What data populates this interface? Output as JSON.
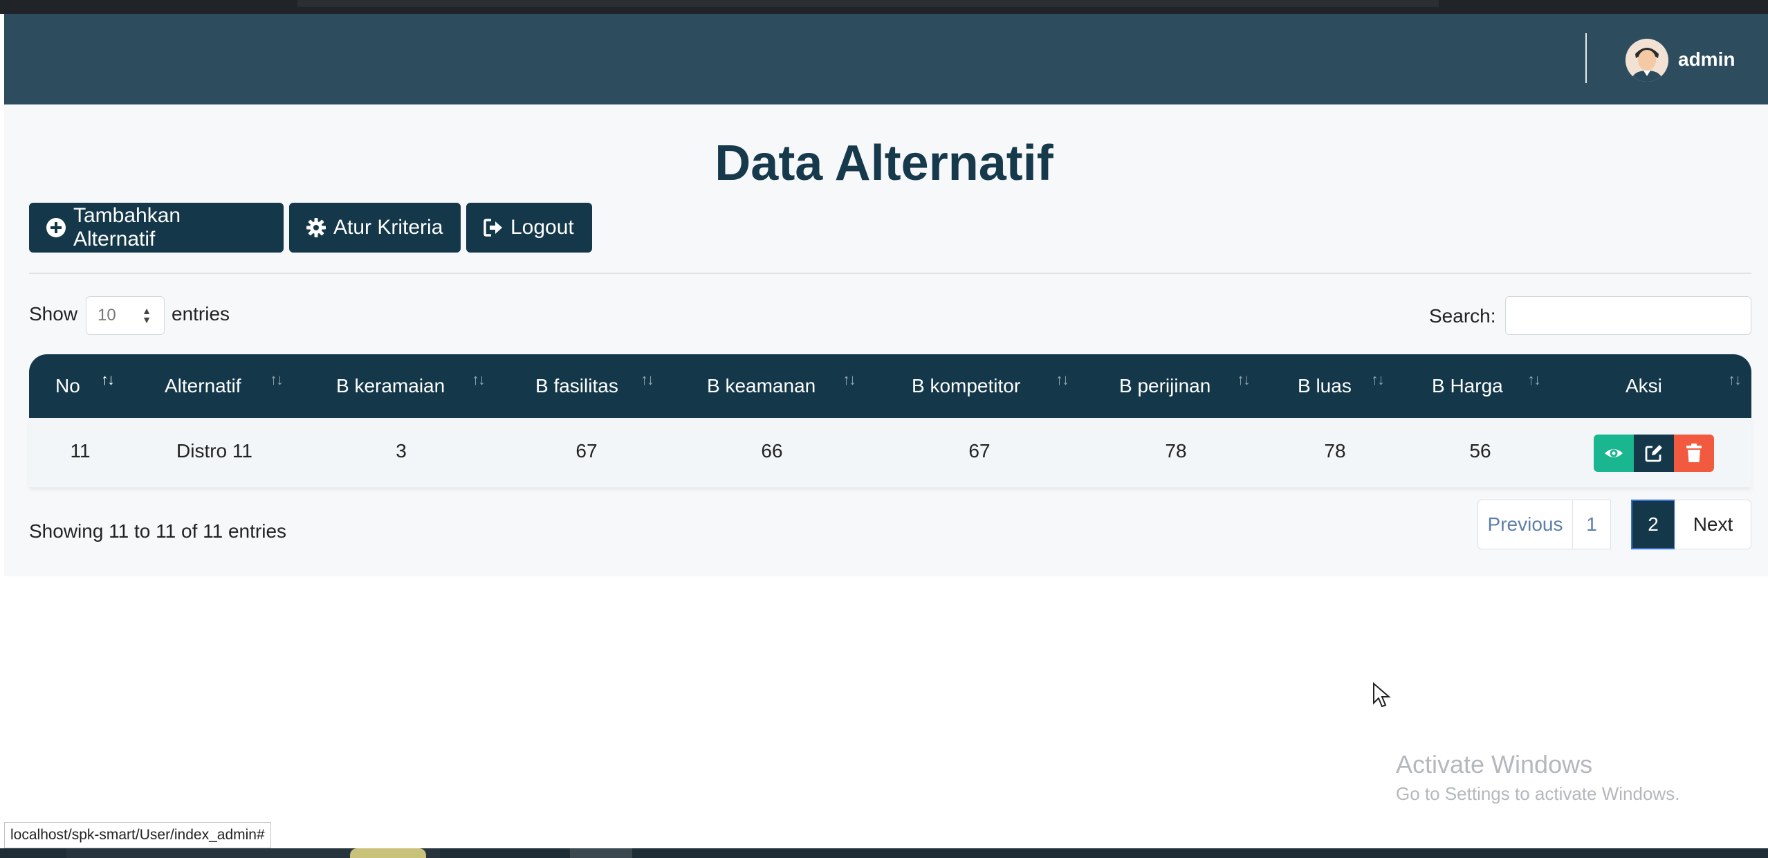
{
  "navbar": {
    "user_name": "admin"
  },
  "page": {
    "title": "Data Alternatif"
  },
  "toolbar": {
    "add_label": "Tambahkan Alternatif",
    "kriteria_label": "Atur Kriteria",
    "logout_label": "Logout"
  },
  "table_controls": {
    "show_label": "Show",
    "page_length": "10",
    "entries_label": "entries",
    "search_label": "Search:",
    "search_value": ""
  },
  "table": {
    "columns": [
      "No",
      "Alternatif",
      "B keramaian",
      "B fasilitas",
      "B keamanan",
      "B kompetitor",
      "B perijinan",
      "B luas",
      "B Harga",
      "Aksi"
    ],
    "rows": [
      [
        "11",
        "Distro 11",
        "3",
        "67",
        "66",
        "67",
        "78",
        "78",
        "56"
      ]
    ]
  },
  "footer": {
    "info": "Showing 11 to 11 of 11 entries",
    "prev_label": "Previous",
    "page_1": "1",
    "page_2": "2",
    "next_label": "Next"
  },
  "watermark": {
    "title": "Activate Windows",
    "subtitle": "Go to Settings to activate Windows."
  },
  "status_bar": {
    "url": "localhost/spk-smart/User/index_admin#"
  },
  "colors": {
    "navbar": "#2d4d5f",
    "primary": "#14384a",
    "view": "#19b690",
    "delete": "#f25a3f"
  }
}
